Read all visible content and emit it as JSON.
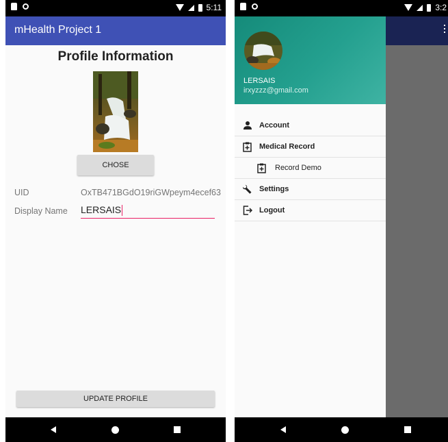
{
  "left_screen": {
    "status_time": "5:11",
    "app_title": "mHealth Project 1",
    "heading": "Profile Information",
    "chose_button": "CHOSE",
    "uid_label": "UID",
    "uid_value": "OxTB471BGdO19riGWpeym4ecef63",
    "display_name_label": "Display Name",
    "display_name_value": "LERSAIS",
    "update_button": "UPDATE PROFILE"
  },
  "right_screen": {
    "status_time": "3:2",
    "drawer_header": {
      "name": "LERSAIS",
      "email": "irxyzzz@gmail.com"
    },
    "menu": [
      {
        "label": "Account",
        "icon": "person-icon"
      },
      {
        "label": "Medical Record",
        "icon": "clipboard-plus-icon"
      },
      {
        "label": "Record Demo",
        "icon": "clipboard-plus-icon"
      },
      {
        "label": "Settings",
        "icon": "wrench-icon"
      },
      {
        "label": "Logout",
        "icon": "logout-icon"
      }
    ]
  },
  "colors": {
    "app_bar": "#3f51b5",
    "drawer_header": "#24a08f",
    "accent": "#e91e63",
    "status_bar": "#000000"
  }
}
